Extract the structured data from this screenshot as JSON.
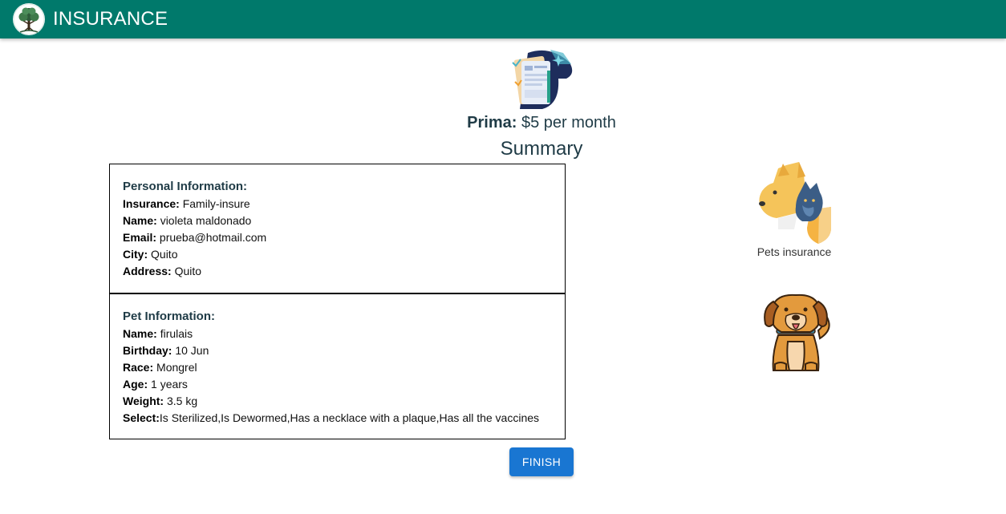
{
  "header": {
    "title": "INSURANCE",
    "logo_icon": "tree-logo-icon",
    "background_color": "#00796b"
  },
  "hero": {
    "icon": "insurance-document-icon",
    "prima_label": "Prima:",
    "prima_value": "$5 per month",
    "summary_title": "Summary"
  },
  "personal": {
    "title": "Personal Information:",
    "fields": [
      {
        "label": "Insurance:",
        "value": "Family-insure"
      },
      {
        "label": "Name:",
        "value": "violeta maldonado"
      },
      {
        "label": "Email:",
        "value": "prueba@hotmail.com"
      },
      {
        "label": "City:",
        "value": "Quito"
      },
      {
        "label": "Address:",
        "value": "Quito"
      }
    ]
  },
  "pet": {
    "title": "Pet Information:",
    "fields": [
      {
        "label": "Name:",
        "value": "firulais"
      },
      {
        "label": "Birthday:",
        "value": "10 Jun"
      },
      {
        "label": "Race:",
        "value": "Mongrel"
      },
      {
        "label": "Age:",
        "value": "1 years"
      },
      {
        "label": "Weight:",
        "value": "3.5 kg"
      },
      {
        "label": "Select:",
        "value": "Is Sterilized,Is Dewormed,Has a necklace with a plaque,Has all the vaccines"
      }
    ]
  },
  "actions": {
    "finish_label": "FINISH",
    "finish_color": "#1976d2"
  },
  "side": {
    "pets_icon": "dog-cat-shield-icon",
    "pets_label": "Pets insurance",
    "dog_icon": "sitting-dog-icon"
  }
}
